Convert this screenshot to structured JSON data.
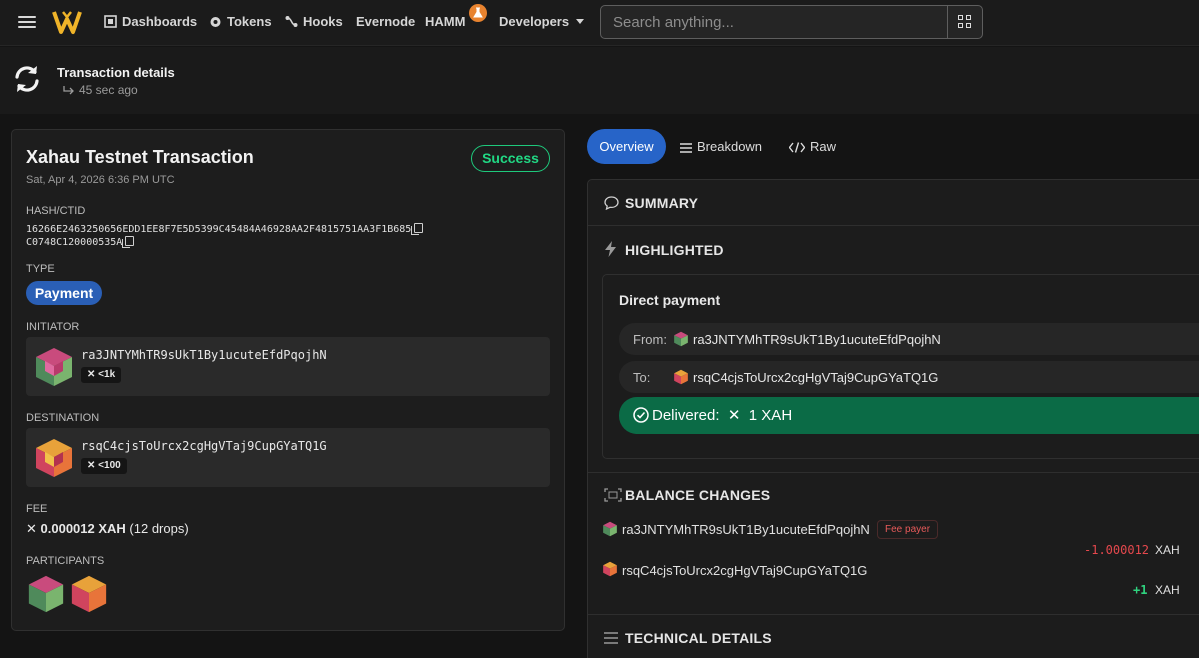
{
  "nav": {
    "items": {
      "dashboards": "Dashboards",
      "tokens": "Tokens",
      "hooks": "Hooks",
      "evernode": "Evernode",
      "hamm": "HAMM",
      "developers": "Developers"
    },
    "search_placeholder": "Search anything..."
  },
  "titlebar": {
    "title": "Transaction details",
    "time_ago": "45 sec ago"
  },
  "tx": {
    "title": "Xahau Testnet Transaction",
    "date": "Sat, Apr 4, 2026 6:36 PM UTC",
    "status": "Success",
    "hash_label": "HASH/CTID",
    "hash": "16266E2463250656EDD1EE8F7E5D5399C45484A46928AA2F4815751AA3F1B685",
    "ctid": "C0748C120000535A",
    "type_label": "TYPE",
    "type": "Payment",
    "initiator_label": "INITIATOR",
    "initiator": {
      "address": "ra3JNTYMhTR9sUkT1By1ucuteEfdPqojhN",
      "balance": "<1k"
    },
    "destination_label": "DESTINATION",
    "destination": {
      "address": "rsqC4cjsToUrcx2cgHgVTaj9CupGYaTQ1G",
      "balance": "<100"
    },
    "fee_label": "FEE",
    "fee_amount": "0.000012 XAH",
    "fee_drops": "(12 drops)",
    "participants_label": "PARTICIPANTS"
  },
  "tabs": {
    "overview": "Overview",
    "breakdown": "Breakdown",
    "raw": "Raw"
  },
  "summary": {
    "summary_title": "SUMMARY",
    "highlighted_title": "HIGHLIGHTED",
    "direct_payment": "Direct payment",
    "from_label": "From:",
    "from_address": "ra3JNTYMhTR9sUkT1By1ucuteEfdPqojhN",
    "to_label": "To:",
    "to_address": "rsqC4cjsToUrcx2cgHgVTaj9CupGYaTQ1G",
    "delivered_label": "Delivered:",
    "delivered_amount": "1 XAH"
  },
  "balance_changes": {
    "title": "BALANCE CHANGES",
    "rows": [
      {
        "address": "ra3JNTYMhTR9sUkT1By1ucuteEfdPqojhN",
        "tag": "Fee payer",
        "delta": "-1.000012",
        "currency": "XAH"
      },
      {
        "address": "rsqC4cjsToUrcx2cgHgVTaj9CupGYaTQ1G",
        "delta": "+1",
        "currency": "XAH"
      }
    ]
  },
  "technical": {
    "title": "TECHNICAL DETAILS"
  },
  "colors": {
    "success": "#21d884",
    "accent": "#2764c8",
    "delivered_bg": "#0b6b46",
    "negative": "#e5484d",
    "positive": "#2fd37f"
  }
}
